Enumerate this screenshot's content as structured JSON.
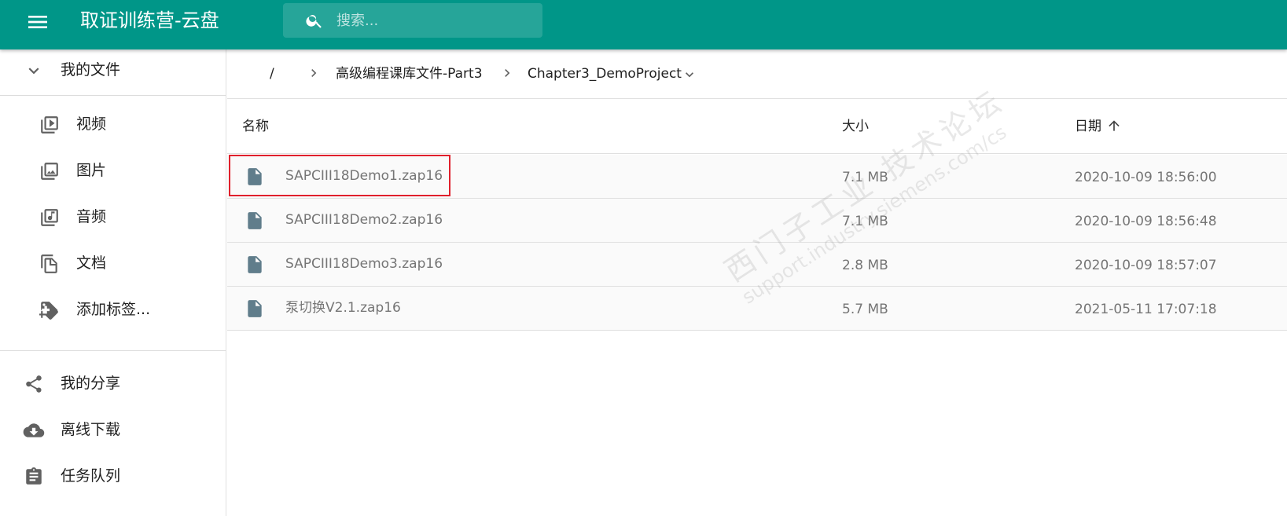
{
  "app": {
    "title": "取证训练营-云盘",
    "search_placeholder": "搜索...",
    "header_color": "#009688"
  },
  "sidebar": {
    "my_files_label": "我的文件",
    "items": [
      {
        "label": "视频",
        "icon": "video-library-icon"
      },
      {
        "label": "图片",
        "icon": "photo-library-icon"
      },
      {
        "label": "音频",
        "icon": "music-library-icon"
      },
      {
        "label": "文档",
        "icon": "file-copy-icon"
      },
      {
        "label": "添加标签...",
        "icon": "add-tag-icon"
      }
    ],
    "bottom_items": [
      {
        "label": "我的分享",
        "icon": "share-icon"
      },
      {
        "label": "离线下载",
        "icon": "cloud-download-icon"
      },
      {
        "label": "任务队列",
        "icon": "clipboard-icon"
      }
    ]
  },
  "breadcrumb": {
    "root": "/",
    "parts": [
      "高级编程课库文件-Part3",
      "Chapter3_DemoProject"
    ]
  },
  "table": {
    "columns": {
      "name": "名称",
      "size": "大小",
      "date": "日期"
    },
    "sort": "date-ascending",
    "rows": [
      {
        "name": "SAPCIII18Demo1.zap16",
        "size": "7.1 MB",
        "date": "2020-10-09 18:56:00",
        "highlighted": true
      },
      {
        "name": "SAPCIII18Demo2.zap16",
        "size": "7.1 MB",
        "date": "2020-10-09 18:56:48"
      },
      {
        "name": "SAPCIII18Demo3.zap16",
        "size": "2.8 MB",
        "date": "2020-10-09 18:57:07"
      },
      {
        "name": "泵切换V2.1.zap16",
        "size": "5.7 MB",
        "date": "2021-05-11 17:07:18"
      }
    ]
  },
  "watermark": {
    "line1": "西门子工业 技术论坛",
    "line2": "support.industry.siemens.com/cs"
  },
  "colors": {
    "highlight_box": "#e0202c",
    "file_icon": "#607d8b"
  }
}
